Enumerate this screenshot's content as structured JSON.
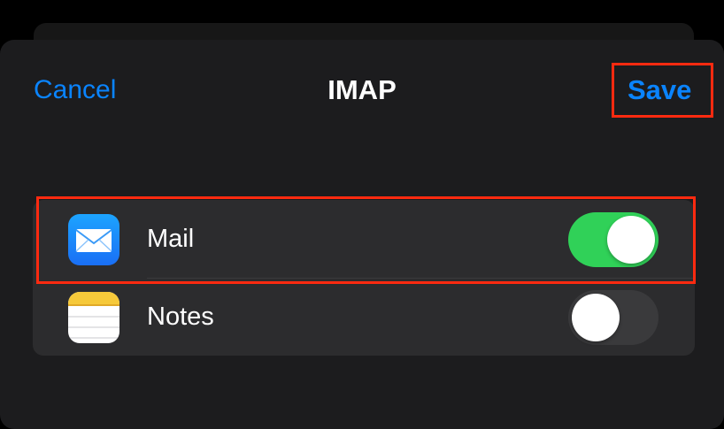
{
  "nav": {
    "cancel_label": "Cancel",
    "title": "IMAP",
    "save_label": "Save"
  },
  "apps": [
    {
      "label": "Mail",
      "icon": "mail-icon",
      "enabled": true
    },
    {
      "label": "Notes",
      "icon": "notes-icon",
      "enabled": false
    }
  ],
  "colors": {
    "accent": "#0a84ff",
    "toggle_on": "#30d158",
    "highlight": "#ff2a10"
  }
}
